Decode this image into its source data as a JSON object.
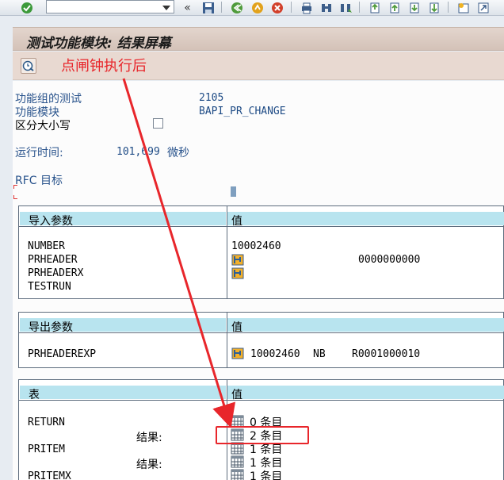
{
  "toolbar": {
    "icons": [
      "check-icon",
      "dropdown-icon",
      "back-icon",
      "save-icon",
      "back-green-icon",
      "exit-icon",
      "cancel-icon",
      "print-icon",
      "find-icon",
      "find-next-icon",
      "first-page-icon",
      "prev-page-icon",
      "next-page-icon",
      "last-page-icon",
      "new-session-icon",
      "shortcut-icon"
    ],
    "collapse_glyph": "«"
  },
  "title": "测试功能模块: 结果屏幕",
  "annotation": {
    "text": "点闸钟执行后"
  },
  "info": {
    "group_label": "功能组的测试",
    "group_value": "2105",
    "module_label": "功能模块",
    "module_value": "BAPI_PR_CHANGE",
    "case_label": "区分大小写",
    "runtime_label": "运行时间:",
    "runtime_value": "101,699",
    "runtime_unit": "微秒",
    "rfc_label": "RFC 目标"
  },
  "import": {
    "header": "导入参数",
    "value_header": "值",
    "params": [
      "NUMBER",
      "PRHEADER",
      "PRHEADERX",
      "TESTRUN"
    ],
    "number_value": "10002460",
    "prheader_value": "0000000000"
  },
  "export": {
    "header": "导出参数",
    "value_header": "值",
    "param": "PRHEADEREXP",
    "v1": "10002460",
    "v2": "NB",
    "v3": "R0001000010"
  },
  "tables": {
    "header": "表",
    "value_header": "值",
    "rows": [
      {
        "name": "RETURN",
        "entries": "0 条目"
      },
      {
        "name": "",
        "result": "结果:",
        "entries": "2 条目"
      },
      {
        "name": "PRITEM",
        "entries": "1 条目"
      },
      {
        "name": "",
        "result": "结果:",
        "entries": "1 条目"
      },
      {
        "name": "PRITEMX",
        "entries": "1 条目"
      }
    ]
  },
  "colors": {
    "annotation": "#e8262b",
    "section_header": "#b8e4ef",
    "title_bar": "#d9c8be",
    "label_blue": "#29538c"
  }
}
